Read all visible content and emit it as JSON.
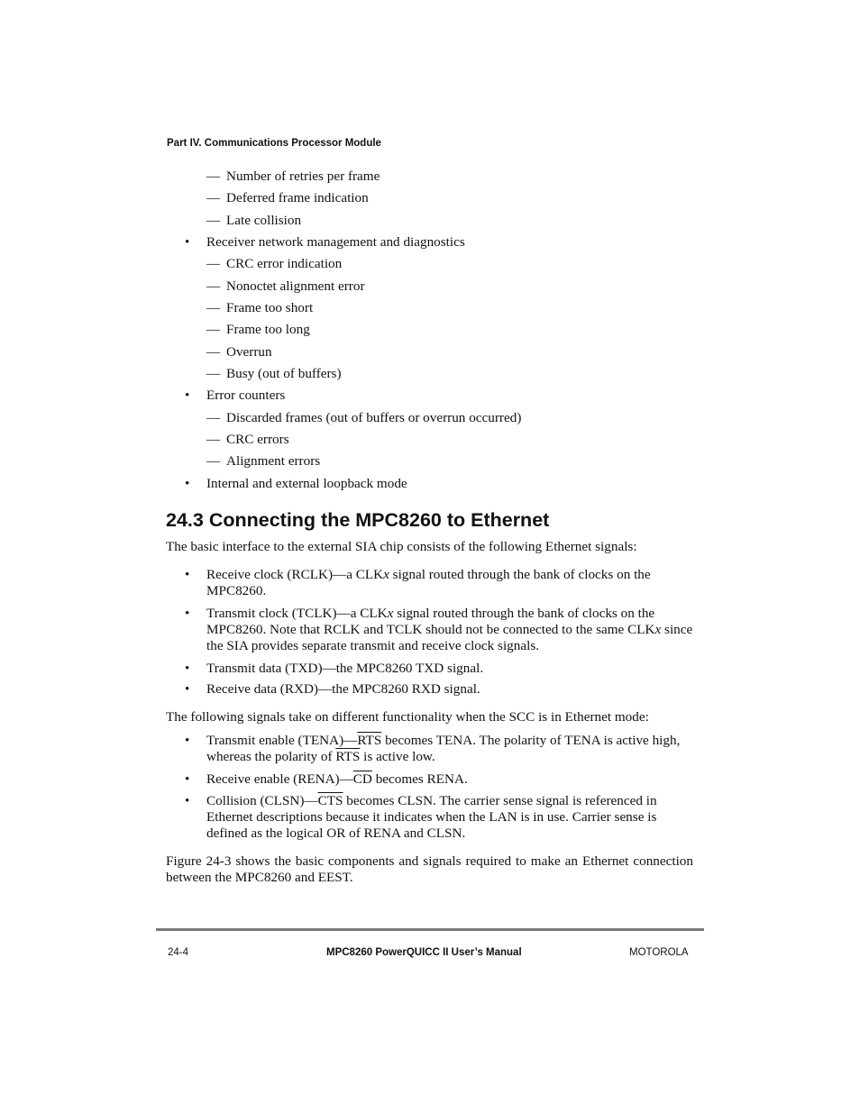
{
  "header": {
    "part": "Part IV.  Communications Processor Module"
  },
  "list_top": [
    {
      "type": "dash",
      "text": "Number of retries per frame"
    },
    {
      "type": "dash",
      "text": "Deferred frame indication"
    },
    {
      "type": "dash",
      "text": "Late collision"
    },
    {
      "type": "bullet",
      "text": "Receiver network management and diagnostics"
    },
    {
      "type": "dash",
      "text": "CRC error indication"
    },
    {
      "type": "dash",
      "text": "Nonoctet alignment error"
    },
    {
      "type": "dash",
      "text": "Frame too short"
    },
    {
      "type": "dash",
      "text": "Frame too long"
    },
    {
      "type": "dash",
      "text": "Overrun"
    },
    {
      "type": "dash",
      "text": "Busy (out of buffers)"
    },
    {
      "type": "bullet",
      "text": "Error counters"
    },
    {
      "type": "dash",
      "text": "Discarded frames (out of buffers or overrun occurred)"
    },
    {
      "type": "dash",
      "text": "CRC errors"
    },
    {
      "type": "dash",
      "text": "Alignment errors"
    },
    {
      "type": "bullet",
      "text": "Internal and external loopback mode"
    }
  ],
  "markers": {
    "dash": "—",
    "bullet": "•"
  },
  "section": {
    "heading": "24.3  Connecting the MPC8260 to Ethernet",
    "intro": "The basic interface to the external SIA chip consists of the following Ethernet signals:",
    "signals": [
      {
        "a": "Receive clock (RCLK)—a CLK",
        "x": "x",
        "b": " signal routed through the bank of clocks on the MPC8260."
      },
      {
        "a": "Transmit clock (TCLK)—a CLK",
        "x": "x",
        "b": " signal routed through the bank of clocks on the MPC8260. Note that RCLK and TCLK should not be connected to the same CLK",
        "x2": "x",
        "c": " since the SIA provides separate transmit and receive clock signals."
      },
      {
        "a": "Transmit data (TXD)—the MPC8260 TXD signal."
      },
      {
        "a": "Receive data (RXD)—the MPC8260 RXD signal."
      }
    ],
    "mode_intro": "The following signals take on different functionality when the SCC is in Ethernet mode:",
    "mode_signals": [
      {
        "a": "Transmit enable (TENA)—",
        "ov1": "RTS",
        "b": " becomes TENA. The polarity of TENA is active high, whereas the polarity of ",
        "ov2": "RTS",
        "c": " is active low."
      },
      {
        "a": "Receive enable (RENA)—",
        "ov1": "CD",
        "b": " becomes RENA."
      },
      {
        "a": "Collision (CLSN)—",
        "ov1": "CTS",
        "b": " becomes CLSN. The carrier sense signal is referenced in Ethernet descriptions because it indicates when the LAN is in use. Carrier sense is defined as the logical OR of RENA and CLSN."
      }
    ],
    "closing": "Figure 24-3 shows the basic components and signals required to make an Ethernet connection between the MPC8260 and EEST."
  },
  "footer": {
    "page": "24-4",
    "title": "MPC8260 PowerQUICC II User’s Manual",
    "brand": "MOTOROLA"
  }
}
